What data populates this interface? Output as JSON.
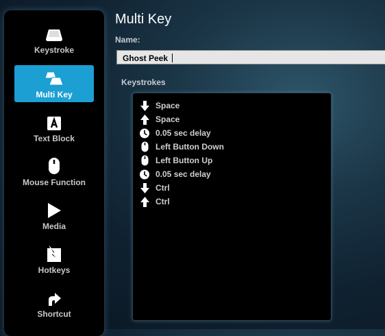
{
  "sidebar": {
    "items": [
      {
        "label": "Keystroke",
        "icon": "keycap-icon"
      },
      {
        "label": "Multi Key",
        "icon": "multi-keycap-icon",
        "active": true
      },
      {
        "label": "Text Block",
        "icon": "text-block-icon"
      },
      {
        "label": "Mouse Function",
        "icon": "mouse-icon"
      },
      {
        "label": "Media",
        "icon": "play-icon"
      },
      {
        "label": "Hotkeys",
        "icon": "hotkey-icon"
      },
      {
        "label": "Shortcut",
        "icon": "shortcut-arrow-icon"
      }
    ]
  },
  "main": {
    "title": "Multi Key",
    "name_label": "Name:",
    "name_value": "Ghost Peek",
    "keystrokes_label": "Keystrokes",
    "keystrokes": [
      {
        "icon": "key-down-arrow-icon",
        "text": "Space"
      },
      {
        "icon": "key-up-arrow-icon",
        "text": "Space"
      },
      {
        "icon": "clock-icon",
        "text": "0.05 sec delay"
      },
      {
        "icon": "mouse-icon",
        "text": "Left Button Down"
      },
      {
        "icon": "mouse-icon",
        "text": "Left Button Up"
      },
      {
        "icon": "clock-icon",
        "text": "0.05 sec delay"
      },
      {
        "icon": "key-down-arrow-icon",
        "text": "Ctrl"
      },
      {
        "icon": "key-up-arrow-icon",
        "text": "Ctrl"
      }
    ]
  },
  "colors": {
    "accent": "#1c9fd3",
    "panel": "#000000"
  }
}
